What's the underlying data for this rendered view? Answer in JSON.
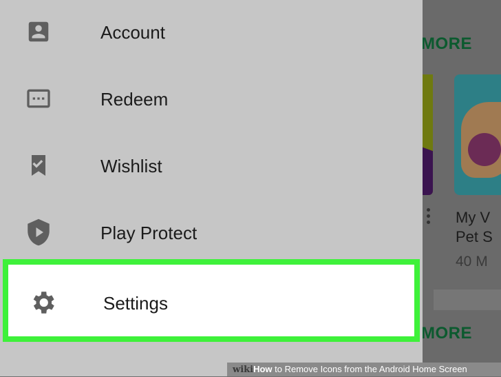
{
  "background": {
    "more_label_top": "MORE",
    "more_label_bottom": "MORE",
    "app_name": "My V\nPet S",
    "app_size": "40 M"
  },
  "drawer": {
    "items": [
      {
        "label": "Account",
        "icon": "account-box-icon"
      },
      {
        "label": "Redeem",
        "icon": "redeem-card-icon"
      },
      {
        "label": "Wishlist",
        "icon": "wishlist-bookmark-icon"
      },
      {
        "label": "Play Protect",
        "icon": "shield-play-icon"
      },
      {
        "label": "Settings",
        "icon": "gear-icon",
        "highlighted": true
      }
    ]
  },
  "caption": {
    "brand": "wiki",
    "how": "How",
    "title": " to Remove Icons from the Android Home Screen"
  },
  "colors": {
    "drawer_bg": "#c6c6c6",
    "highlight_border": "#3ef13a",
    "icon_color": "#5f5f5f",
    "more_green": "#0c5a2f"
  }
}
